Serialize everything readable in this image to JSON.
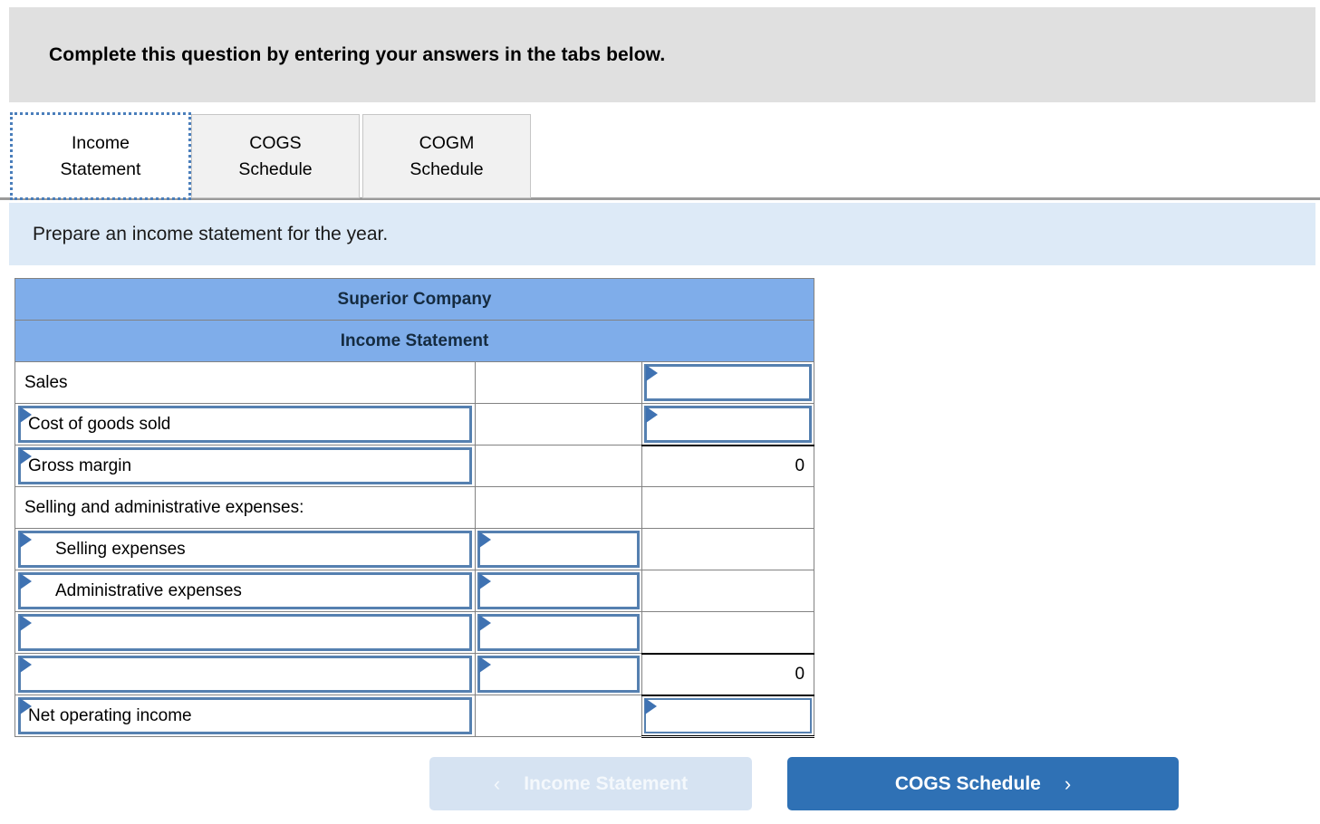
{
  "banner": {
    "text": "Complete this question by entering your answers in the tabs below."
  },
  "tabs": [
    {
      "label_line1": "Income",
      "label_line2": "Statement",
      "active": true
    },
    {
      "label_line1": "COGS",
      "label_line2": "Schedule",
      "active": false
    },
    {
      "label_line1": "COGM",
      "label_line2": "Schedule",
      "active": false
    }
  ],
  "requirement": {
    "text": "Prepare an income statement for the year."
  },
  "worksheet": {
    "title_line1": "Superior Company",
    "title_line2": "Income Statement",
    "rows": [
      {
        "label": "Sales",
        "label_kind": "plain",
        "indent": false,
        "mid_kind": "blank",
        "mid_value": "",
        "right_kind": "input",
        "right_value": ""
      },
      {
        "label": "Cost of goods sold",
        "label_kind": "input",
        "indent": false,
        "mid_kind": "blank",
        "mid_value": "",
        "right_kind": "input",
        "right_value": ""
      },
      {
        "label": "Gross margin",
        "label_kind": "input",
        "indent": false,
        "mid_kind": "blank",
        "mid_value": "",
        "right_kind": "total",
        "right_value": "0"
      },
      {
        "label": "Selling and administrative expenses:",
        "label_kind": "plain",
        "indent": false,
        "mid_kind": "blank",
        "mid_value": "",
        "right_kind": "blank",
        "right_value": ""
      },
      {
        "label": "Selling expenses",
        "label_kind": "input",
        "indent": true,
        "mid_kind": "input",
        "mid_value": "",
        "right_kind": "blank",
        "right_value": ""
      },
      {
        "label": "Administrative expenses",
        "label_kind": "input",
        "indent": true,
        "mid_kind": "input",
        "mid_value": "",
        "right_kind": "blank",
        "right_value": ""
      },
      {
        "label": "",
        "label_kind": "input",
        "indent": false,
        "mid_kind": "input",
        "mid_value": "",
        "right_kind": "blank",
        "right_value": ""
      },
      {
        "label": "",
        "label_kind": "input",
        "indent": false,
        "mid_kind": "input",
        "mid_value": "",
        "right_kind": "subtotal",
        "right_value": "0"
      },
      {
        "label": "Net operating income",
        "label_kind": "input",
        "indent": false,
        "mid_kind": "blank",
        "mid_value": "",
        "right_kind": "final",
        "right_value": ""
      }
    ]
  },
  "nav": {
    "prev_label": "Income Statement",
    "prev_chevron": "‹",
    "next_label": "COGS Schedule",
    "next_chevron": "›"
  },
  "colors": {
    "banner_gray": "#e0e0e0",
    "requirement_blue": "#ddeaf7",
    "table_header_blue": "#7fadea",
    "field_border_blue": "#5580b0",
    "marker_blue": "#3f72b2",
    "next_button_blue": "#2f71b5",
    "prev_button_blue": "#d6e3f2"
  }
}
